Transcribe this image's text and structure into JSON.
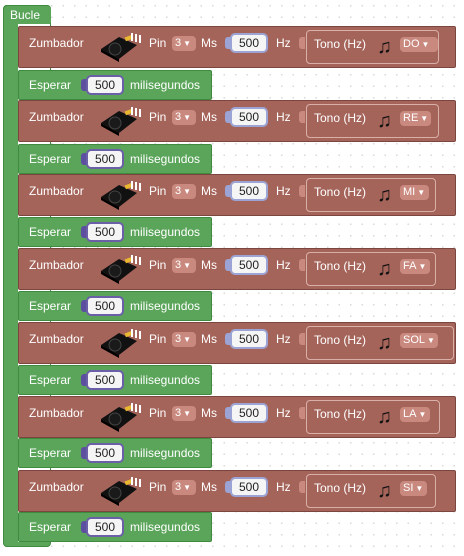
{
  "loop": {
    "label": "Bucle"
  },
  "blocks": [
    {
      "buzzer_label": "Zumbador",
      "pin_label": "Pin",
      "pin_value": "3",
      "ms_label": "Ms",
      "ms_value": "500",
      "hz_label": "Hz",
      "tone_label": "Tono (Hz)",
      "note": "DO",
      "note_icon": "music-note-icon",
      "wait_label": "Esperar",
      "wait_value": "500",
      "wait_unit": "milisegundos"
    },
    {
      "buzzer_label": "Zumbador",
      "pin_label": "Pin",
      "pin_value": "3",
      "ms_label": "Ms",
      "ms_value": "500",
      "hz_label": "Hz",
      "tone_label": "Tono (Hz)",
      "note": "RE",
      "note_icon": "music-note-icon",
      "wait_label": "Esperar",
      "wait_value": "500",
      "wait_unit": "milisegundos"
    },
    {
      "buzzer_label": "Zumbador",
      "pin_label": "Pin",
      "pin_value": "3",
      "ms_label": "Ms",
      "ms_value": "500",
      "hz_label": "Hz",
      "tone_label": "Tono (Hz)",
      "note": "MI",
      "note_icon": "music-note-icon",
      "wait_label": "Esperar",
      "wait_value": "500",
      "wait_unit": "milisegundos"
    },
    {
      "buzzer_label": "Zumbador",
      "pin_label": "Pin",
      "pin_value": "3",
      "ms_label": "Ms",
      "ms_value": "500",
      "hz_label": "Hz",
      "tone_label": "Tono (Hz)",
      "note": "FA",
      "note_icon": "music-note-icon",
      "wait_label": "Esperar",
      "wait_value": "500",
      "wait_unit": "milisegundos"
    },
    {
      "buzzer_label": "Zumbador",
      "pin_label": "Pin",
      "pin_value": "3",
      "ms_label": "Ms",
      "ms_value": "500",
      "hz_label": "Hz",
      "tone_label": "Tono (Hz)",
      "note": "SOL",
      "note_icon": "music-note-icon",
      "wait_label": "Esperar",
      "wait_value": "500",
      "wait_unit": "milisegundos"
    },
    {
      "buzzer_label": "Zumbador",
      "pin_label": "Pin",
      "pin_value": "3",
      "ms_label": "Ms",
      "ms_value": "500",
      "hz_label": "Hz",
      "tone_label": "Tono (Hz)",
      "note": "LA",
      "note_icon": "music-note-icon",
      "wait_label": "Esperar",
      "wait_value": "500",
      "wait_unit": "milisegundos"
    },
    {
      "buzzer_label": "Zumbador",
      "pin_label": "Pin",
      "pin_value": "3",
      "ms_label": "Ms",
      "ms_value": "500",
      "hz_label": "Hz",
      "tone_label": "Tono (Hz)",
      "note": "SI",
      "note_icon": "music-note-icon",
      "wait_label": "Esperar",
      "wait_value": "500",
      "wait_unit": "milisegundos"
    }
  ],
  "colors": {
    "loop_green": "#5ba55b",
    "buzzer_brown": "#a5645a",
    "wait_value_border": "#6b5fa8",
    "ms_value_border": "#9ba4d4"
  }
}
